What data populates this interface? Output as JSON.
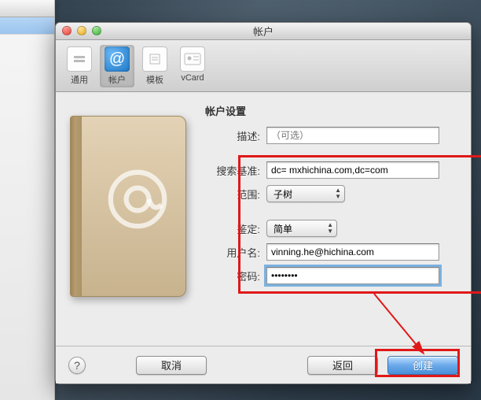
{
  "window": {
    "title": "帐户"
  },
  "toolbar": {
    "items": [
      {
        "label": "通用"
      },
      {
        "label": "帐户"
      },
      {
        "label": "模板"
      },
      {
        "label": "vCard"
      }
    ]
  },
  "section": {
    "title": "帐户设置"
  },
  "form": {
    "description": {
      "label": "描述:",
      "placeholder": "（可选）",
      "value": ""
    },
    "search_base": {
      "label": "搜索基准:",
      "value": "dc= mxhichina.com,dc=com"
    },
    "scope": {
      "label": "范围:",
      "value": "子树"
    },
    "auth": {
      "label": "鉴定:",
      "value": "简单"
    },
    "username": {
      "label": "用户名:",
      "value": "vinning.he@hichina.com"
    },
    "password": {
      "label": "密码:",
      "value": "••••••••"
    }
  },
  "footer": {
    "help": "?",
    "cancel": "取消",
    "back": "返回",
    "create": "创建"
  }
}
